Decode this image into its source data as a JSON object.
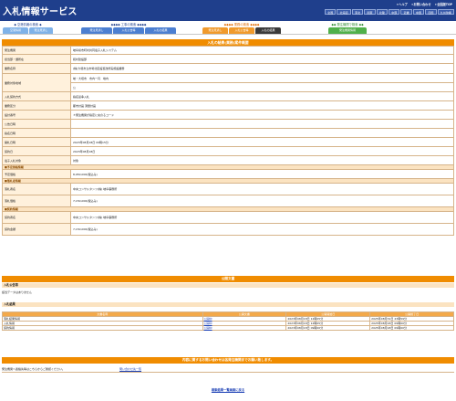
{
  "header": {
    "logo": "入札情報サービス",
    "links": [
      "✦ヘルプ",
      "✦お問い合わせ",
      "✦全国版TOP"
    ],
    "regions": [
      "全国",
      "北海道",
      "東北",
      "関東",
      "北陸",
      "中部",
      "近畿",
      "中国",
      "四国",
      "九州沖縄"
    ]
  },
  "nav": {
    "groups": [
      {
        "title": "◆ 空港情報の検索 ◆",
        "tabs": [
          "空港情報",
          "発注見通し"
        ]
      },
      {
        "title": "◆◆◆◆ 工事の検索 ◆◆◆◆",
        "tabs": [
          "発注見通し",
          "入札公告等",
          "入札の結果"
        ]
      },
      {
        "title": "◆◆◆◆ 業務の検索 ◆◆◆◆",
        "tabs": [
          "発注見通し",
          "入札公告等",
          "入札の結果"
        ]
      },
      {
        "title": "◆◆ 発注機関で検索 ◆◆",
        "tabs": [
          "発注機関情報"
        ]
      }
    ]
  },
  "detail": {
    "title": "入札の結果(業務)案件概要",
    "rows": [
      {
        "label": "発注機関",
        "value": "岐阜県市町村共同電子入札システム"
      },
      {
        "label": "担当部・課所在",
        "value": "和村建設部"
      },
      {
        "label": "業務名称",
        "value": "(株)大垣市立市場北区設置改修実施設業務"
      },
      {
        "label": "業務対象地域",
        "value": "岐・大垣市　市内一円　地内"
      },
      {
        "label": "",
        "value": "公"
      },
      {
        "label": "入札契約方式",
        "value": "指名競争入札"
      },
      {
        "label": "業務区分",
        "value": "都市計画  測量計画"
      },
      {
        "label": "設計番号",
        "value": "＊発注機関が指定に充のるコード"
      },
      {
        "label": "公告日時",
        "value": ""
      },
      {
        "label": "指名日時",
        "value": ""
      },
      {
        "label": "開札日時",
        "value": "2023年08月18日 09時15分"
      },
      {
        "label": "契約日",
        "value": "2023年08月18日"
      },
      {
        "label": "電子入札対象",
        "value": "対象"
      }
    ],
    "sections": [
      {
        "title": "■予定価格情報",
        "rows": [
          {
            "label": "予定価格",
            "value": "8,950,000(税込み)"
          }
        ]
      },
      {
        "title": "■落札者情報",
        "rows": [
          {
            "label": "落札者名",
            "value": "中央コンサルタンツ(株) 岐阜事務所"
          },
          {
            "label": "落札価格",
            "value": "7,150,000(税込み)"
          }
        ]
      },
      {
        "title": "■契約情報",
        "rows": [
          {
            "label": "契約者名",
            "value": "中央コンサルタンツ(株) 岐阜事務所"
          },
          {
            "label": "契約金額",
            "value": "7,150,000(税込み)"
          }
        ]
      }
    ]
  },
  "docs": {
    "title": "公開文書",
    "notice_head": "入札公告等",
    "notice_empty": "該当データはありません",
    "result_head": "入札結果",
    "columns": [
      "文書名称",
      "公開文書",
      "公開開始日",
      "公開終了日"
    ],
    "rows": [
      {
        "name": "落札結果情報",
        "file": "公開中",
        "start": "2023年08月18日 12時05分",
        "end": "2025年08月31日 23時59分"
      },
      {
        "name": "入札情報",
        "file": "公開中",
        "start": "2023年08月18日 12時05分",
        "end": "2025年08月18日 09時00分"
      },
      {
        "name": "契約情報",
        "file": "公開中",
        "start": "2023年08月18日 09時00分",
        "end": "2025年08月18日 09時00分"
      }
    ]
  },
  "contact": {
    "title": "内容に関するお問い合わせは各発注機関までお願い致します。",
    "text": "発注機関へ連絡先等はこちらからご確認ください。",
    "link": "問い合わせ先一覧"
  },
  "back": "検索結果一覧画面に戻る"
}
